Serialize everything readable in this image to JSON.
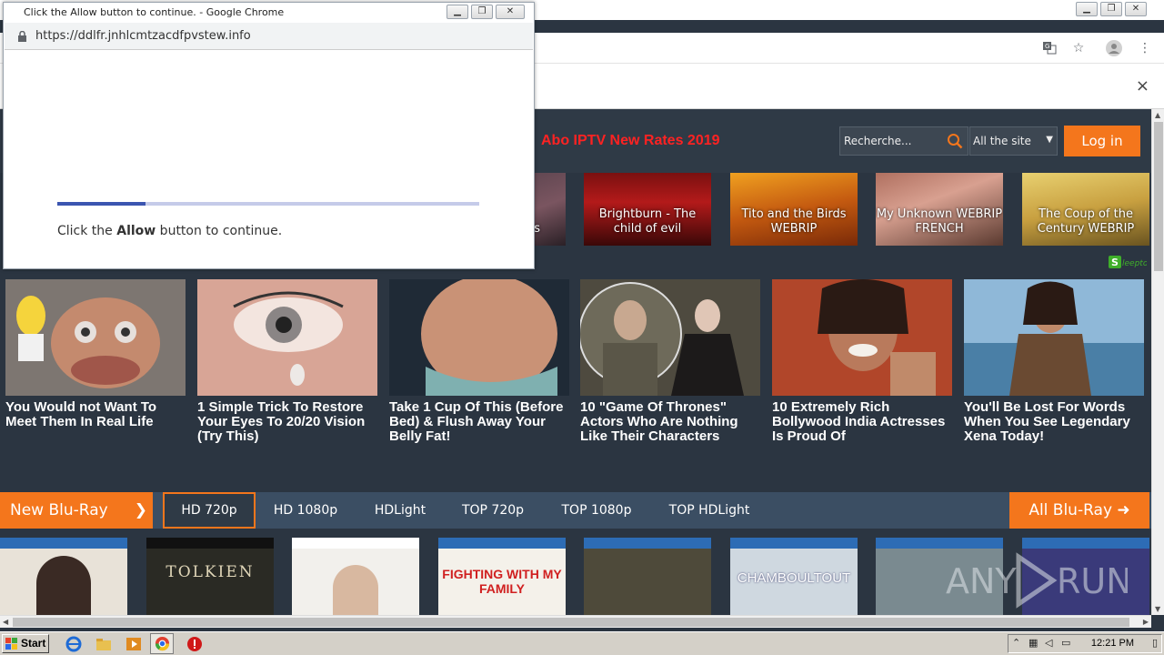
{
  "main_window": {
    "address_icons": [
      "translate-icon",
      "star-icon",
      "profile-icon",
      "menu-icon"
    ],
    "infobar_close": "×"
  },
  "site": {
    "promo_link": "Abo IPTV New Rates 2019",
    "search_placeholder": "Recherche...",
    "scope_value": "All the site",
    "login_label": "Log in",
    "movies": [
      {
        "title": "s"
      },
      {
        "title": "Brightburn - The child of evil"
      },
      {
        "title": "Tito and the Birds WEBRIP"
      },
      {
        "title": "My Unknown WEBRIP FRENCH"
      },
      {
        "title": "The Coup of the Century WEBRIP"
      }
    ],
    "ad_logo": "Sleepto",
    "ads": [
      {
        "title": "You Would not Want To Meet Them In Real Life"
      },
      {
        "title": "1 Simple Trick To Restore Your Eyes To 20/20 Vision (Try This)"
      },
      {
        "title": "Take 1 Cup Of This (Before Bed) & Flush Away Your Belly Fat!"
      },
      {
        "title": "10 \"Game Of Thrones\" Actors Who Are Nothing Like Their Characters"
      },
      {
        "title": "10 Extremely Rich Bollywood India Actresses Is Proud Of"
      },
      {
        "title": "You'll Be Lost For Words When You See Legendary Xena Today!"
      }
    ],
    "bluray": {
      "heading": "New Blu-Ray",
      "tabs": [
        "HD 720p",
        "HD 1080p",
        "HDLight",
        "TOP 720p",
        "TOP 1080p",
        "TOP HDLight"
      ],
      "all_label": "All Blu-Ray"
    },
    "covers": [
      {
        "title": ""
      },
      {
        "title": "TOLKIEN"
      },
      {
        "title": ""
      },
      {
        "title": "FIGHTING WITH MY FAMILY"
      },
      {
        "title": ""
      },
      {
        "title": "CHAMBOULTOUT"
      },
      {
        "title": ""
      },
      {
        "title": ""
      }
    ]
  },
  "popup": {
    "title": "Click the Allow button to continue. - Google Chrome",
    "url": "https://ddlfr.jnhlcmtzacdfpvstew.info",
    "progress": 0.21,
    "message_prefix": "Click the ",
    "message_bold": "Allow",
    "message_suffix": " button to continue."
  },
  "taskbar": {
    "start_label": "Start",
    "clock": "12:21 PM"
  },
  "watermark": "ANY RUN",
  "colors": {
    "accent": "#f4761c",
    "page_bg": "#2b3541",
    "promo": "#ff2222",
    "progress": "#3b55b0"
  }
}
